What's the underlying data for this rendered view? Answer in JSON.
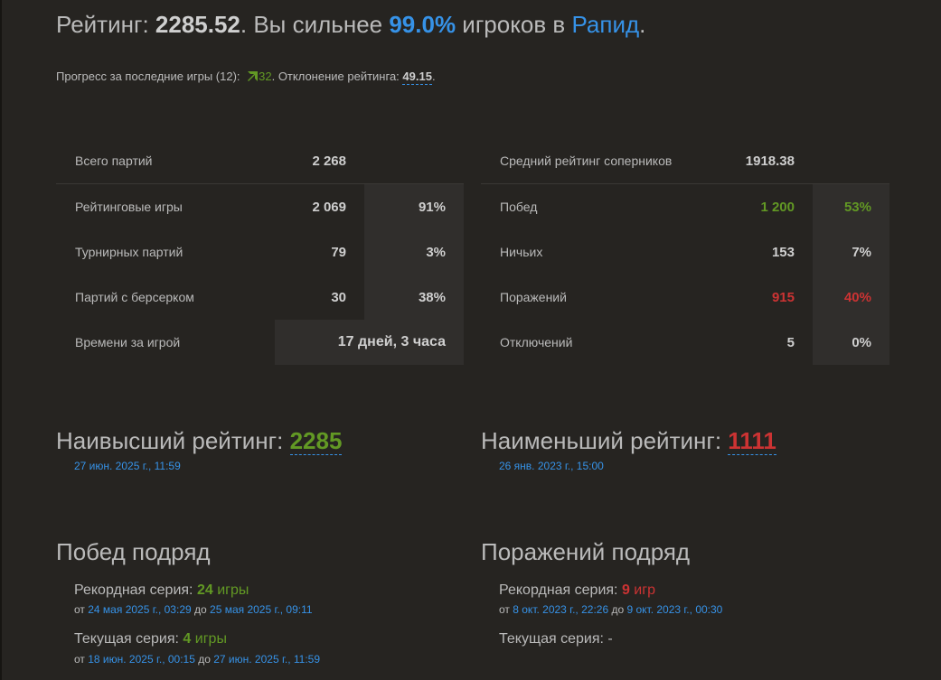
{
  "header": {
    "rating_label": "Рейтинг: ",
    "rating": "2285.52",
    "stronger_text": ". Вы сильнее ",
    "percent": "99.0%",
    "players_in": " игроков в ",
    "variant": "Рапид",
    "end_dot": "."
  },
  "progress": {
    "label": "Прогресс за последние игры (12): ",
    "value": "32",
    "deviation_label": ". Отклонение рейтинга: ",
    "deviation": "49.15",
    "end_dot": ".",
    "arrow_icon": "arrow-up-right-icon",
    "up_color": "#629924"
  },
  "games": {
    "total_label": "Всего партий",
    "total": "2 268",
    "rows": [
      {
        "label": "Рейтинговые игры",
        "value": "2 069",
        "pct": "91%"
      },
      {
        "label": "Турнирных партий",
        "value": "79",
        "pct": "3%"
      },
      {
        "label": "Партий с берсерком",
        "value": "30",
        "pct": "38%"
      }
    ],
    "time_label": "Времени за игрой",
    "time": "17 дней, 3 часа"
  },
  "results": {
    "avg_label": "Средний рейтинг соперников",
    "avg": "1918.38",
    "rows": [
      {
        "label": "Побед",
        "value": "1 200",
        "pct": "53%",
        "color": "green"
      },
      {
        "label": "Ничьих",
        "value": "153",
        "pct": "7%",
        "color": ""
      },
      {
        "label": "Поражений",
        "value": "915",
        "pct": "40%",
        "color": "red"
      },
      {
        "label": "Отключений",
        "value": "5",
        "pct": "0%",
        "color": ""
      }
    ]
  },
  "highest": {
    "label": "Наивысший рейтинг: ",
    "value": "2285",
    "date": "27 июн. 2025 г., 11:59"
  },
  "lowest": {
    "label": "Наименьший рейтинг: ",
    "value": "1111",
    "date": "26 янв. 2023 г., 15:00"
  },
  "win_streak": {
    "title": "Побед подряд",
    "record_label": "Рекордная серия: ",
    "record_count": "24",
    "record_unit": " игры",
    "record_from": "от ",
    "record_start": "24 мая 2025 г., 03:29",
    "record_to": " до ",
    "record_end": "25 мая 2025 г., 09:11",
    "current_label": "Текущая серия: ",
    "current_count": "4",
    "current_unit": " игры",
    "current_from": "от ",
    "current_start": "18 июн. 2025 г., 00:15",
    "current_to": " до ",
    "current_end": "27 июн. 2025 г., 11:59"
  },
  "loss_streak": {
    "title": "Поражений подряд",
    "record_label": "Рекордная серия: ",
    "record_count": "9",
    "record_unit": " игр",
    "record_from": "от ",
    "record_start": "8 окт. 2023 г., 22:26",
    "record_to": " до ",
    "record_end": "9 окт. 2023 г., 00:30",
    "current_label": "Текущая серия: ",
    "current_value": "-"
  },
  "colors": {
    "background": "#262421",
    "accent_blue": "#3692e7",
    "green": "#629924",
    "red": "#cc3333"
  }
}
